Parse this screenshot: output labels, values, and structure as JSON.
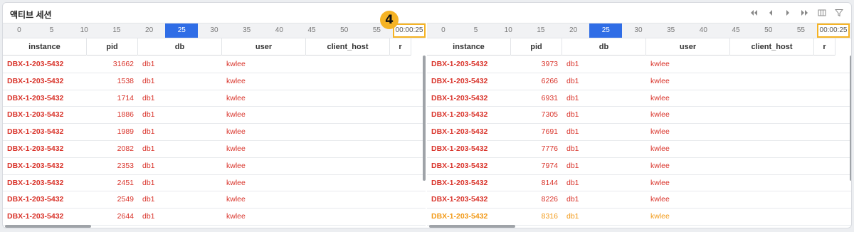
{
  "panel": {
    "title": "액티브 세션"
  },
  "toolbar": {
    "icons": [
      "double-left-icon",
      "left-icon",
      "right-icon",
      "double-right-icon",
      "columns-icon",
      "filter-icon"
    ]
  },
  "callout": {
    "number": "4"
  },
  "timeline": {
    "ticks": [
      "0",
      "5",
      "10",
      "15",
      "20",
      "25",
      "30",
      "35",
      "40",
      "45",
      "50",
      "55"
    ],
    "active": "25",
    "time": "00:00:25"
  },
  "columns": [
    "instance",
    "pid",
    "db",
    "user",
    "client_host",
    "r"
  ],
  "left_table": {
    "rows": [
      {
        "instance": "DBX-1-203-5432",
        "pid": "31662",
        "db": "db1",
        "user": "kwlee"
      },
      {
        "instance": "DBX-1-203-5432",
        "pid": "1538",
        "db": "db1",
        "user": "kwlee"
      },
      {
        "instance": "DBX-1-203-5432",
        "pid": "1714",
        "db": "db1",
        "user": "kwlee"
      },
      {
        "instance": "DBX-1-203-5432",
        "pid": "1886",
        "db": "db1",
        "user": "kwlee"
      },
      {
        "instance": "DBX-1-203-5432",
        "pid": "1989",
        "db": "db1",
        "user": "kwlee"
      },
      {
        "instance": "DBX-1-203-5432",
        "pid": "2082",
        "db": "db1",
        "user": "kwlee"
      },
      {
        "instance": "DBX-1-203-5432",
        "pid": "2353",
        "db": "db1",
        "user": "kwlee"
      },
      {
        "instance": "DBX-1-203-5432",
        "pid": "2451",
        "db": "db1",
        "user": "kwlee"
      },
      {
        "instance": "DBX-1-203-5432",
        "pid": "2549",
        "db": "db1",
        "user": "kwlee"
      },
      {
        "instance": "DBX-1-203-5432",
        "pid": "2644",
        "db": "db1",
        "user": "kwlee"
      }
    ]
  },
  "right_table": {
    "rows": [
      {
        "instance": "DBX-1-203-5432",
        "pid": "3973",
        "db": "db1",
        "user": "kwlee"
      },
      {
        "instance": "DBX-1-203-5432",
        "pid": "6266",
        "db": "db1",
        "user": "kwlee"
      },
      {
        "instance": "DBX-1-203-5432",
        "pid": "6931",
        "db": "db1",
        "user": "kwlee"
      },
      {
        "instance": "DBX-1-203-5432",
        "pid": "7305",
        "db": "db1",
        "user": "kwlee"
      },
      {
        "instance": "DBX-1-203-5432",
        "pid": "7691",
        "db": "db1",
        "user": "kwlee"
      },
      {
        "instance": "DBX-1-203-5432",
        "pid": "7776",
        "db": "db1",
        "user": "kwlee"
      },
      {
        "instance": "DBX-1-203-5432",
        "pid": "7974",
        "db": "db1",
        "user": "kwlee"
      },
      {
        "instance": "DBX-1-203-5432",
        "pid": "8144",
        "db": "db1",
        "user": "kwlee"
      },
      {
        "instance": "DBX-1-203-5432",
        "pid": "8226",
        "db": "db1",
        "user": "kwlee"
      },
      {
        "instance": "DBX-1-203-5432",
        "pid": "8316",
        "db": "db1",
        "user": "kwlee",
        "status": "warning"
      }
    ]
  },
  "colors": {
    "active_tick": "#2f6de6",
    "critical_text": "#d9342b",
    "warning_text": "#f29a18",
    "highlight": "#f5b324"
  }
}
